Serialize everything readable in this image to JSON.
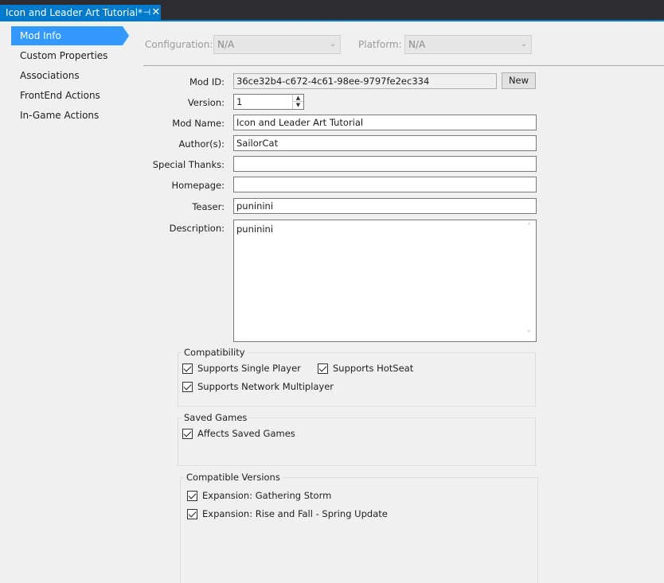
{
  "tab": {
    "title": "Icon and Leader Art Tutorial*",
    "pin_icon": "pin-icon",
    "close_glyph": "✕"
  },
  "sidebar": {
    "items": [
      {
        "label": "Mod Info",
        "active": true
      },
      {
        "label": "Custom Properties",
        "active": false
      },
      {
        "label": "Associations",
        "active": false
      },
      {
        "label": "FrontEnd Actions",
        "active": false
      },
      {
        "label": "In-Game Actions",
        "active": false
      }
    ]
  },
  "config": {
    "configuration_label": "Configuration:",
    "configuration_value": "N/A",
    "platform_label": "Platform:",
    "platform_value": "N/A"
  },
  "form": {
    "mod_id_label": "Mod ID:",
    "mod_id_value": "36ce32b4-c672-4c61-98ee-9797fe2ec334",
    "new_button": "New",
    "version_label": "Version:",
    "version_value": "1",
    "mod_name_label": "Mod Name:",
    "mod_name_value": "Icon and Leader Art Tutorial",
    "authors_label": "Author(s):",
    "authors_value": "SailorCat",
    "special_thanks_label": "Special Thanks:",
    "special_thanks_value": "",
    "homepage_label": "Homepage:",
    "homepage_value": "",
    "teaser_label": "Teaser:",
    "teaser_value": "puninini",
    "description_label": "Description:",
    "description_value": "puninini"
  },
  "compatibility": {
    "title": "Compatibility",
    "single_player": {
      "label": "Supports Single Player",
      "checked": true
    },
    "hotseat": {
      "label": "Supports HotSeat",
      "checked": true
    },
    "network": {
      "label": "Supports Network Multiplayer",
      "checked": true
    }
  },
  "saved_games": {
    "title": "Saved Games",
    "affects": {
      "label": "Affects Saved Games",
      "checked": true
    }
  },
  "compatible_versions": {
    "title": "Compatible Versions",
    "items": [
      {
        "label": "Expansion: Gathering Storm",
        "checked": true
      },
      {
        "label": "Expansion: Rise and Fall - Spring Update",
        "checked": true
      }
    ]
  },
  "colors": {
    "accent": "#007acc",
    "nav_active": "#3399ff",
    "titlebar": "#2d2d30"
  }
}
